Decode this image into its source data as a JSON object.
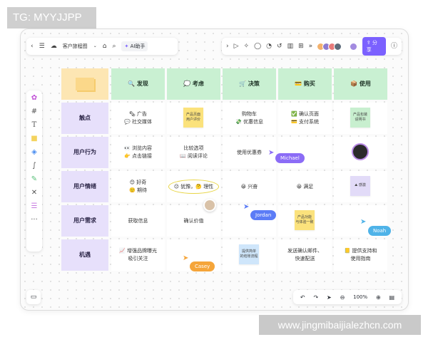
{
  "overlays": {
    "tg_label": "TG: MYYJJPP",
    "watermark": "www.jingmibaijialezhcn.com"
  },
  "toolbar": {
    "doc_title": "客户旅程图",
    "ai_label": "AI助手",
    "share_label": "分享"
  },
  "board": {
    "columns": [
      "🔍 发现",
      "💭 考虑",
      "🛒 决策",
      "💳 购买",
      "📦 使用"
    ],
    "rows": [
      "触点",
      "用户行为",
      "用户情绪",
      "用户需求",
      "机遇"
    ],
    "cells": {
      "r0c0": "🗞 广告\n💬 社交媒体",
      "r0c2": "购物车\n💸 优惠信息",
      "r0c3": "✅ 确认页面\n💳 支付系统",
      "r1c0": "👀 浏览内容\n👉 点击链接",
      "r1c1": "比较选项\n📖 阅读评论",
      "r1c2": "使用优惠券",
      "r2c0": "😊 好奇\n🙂 期待",
      "r2c2": "😀 兴奋",
      "r2c3": "😀 满足",
      "r3c0": "获取信息",
      "r3c1": "确认价值",
      "r4c0": "📈 增强品牌曝光\n吸引关注",
      "r4c2": "发送确认邮件、\n快速配送",
      "r4c4": "📒 提供支持和\n使用指南"
    },
    "emotion_circled": "😐 犹豫，🤔 理性",
    "stickies": {
      "r0c1": "产品页面\n用户评价",
      "r0c4": "产品包装\n说明书",
      "r2c4": "⛰ 感激",
      "r3c3": "产品功能\n与体验一致",
      "r4c2": "提供简单\n的结账流程"
    }
  },
  "collaborators": [
    {
      "name": "Michael",
      "color": "#8b6cf6"
    },
    {
      "name": "Jordan",
      "color": "#5b7cf6"
    },
    {
      "name": "Noah",
      "color": "#4fb3e8"
    },
    {
      "name": "Casey",
      "color": "#f5a53a"
    }
  ],
  "zoom": {
    "level": "100%"
  }
}
